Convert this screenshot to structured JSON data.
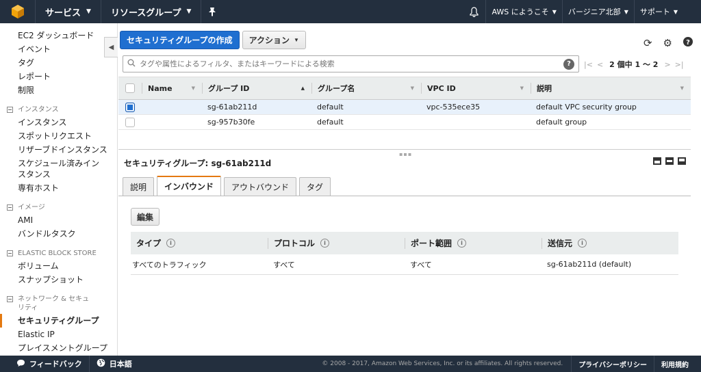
{
  "topnav": {
    "services": "サービス",
    "resource_groups": "リソースグループ",
    "account": "AWS にようこそ",
    "region": "バージニア北部",
    "support": "サポート"
  },
  "sidebar": {
    "top_items": [
      "EC2 ダッシュボード",
      "イベント",
      "タグ",
      "レポート",
      "制限"
    ],
    "sections": [
      {
        "title": "インスタンス",
        "items": [
          "インスタンス",
          "スポットリクエスト",
          "リザーブドインスタンス",
          "スケジュール済みインスタンス",
          "専有ホスト"
        ]
      },
      {
        "title": "イメージ",
        "items": [
          "AMI",
          "バンドルタスク"
        ]
      },
      {
        "title": "ELASTIC BLOCK STORE",
        "items": [
          "ボリューム",
          "スナップショット"
        ]
      },
      {
        "title": "ネットワーク & セキュリティ",
        "items": [
          "セキュリティグループ",
          "Elastic IP",
          "プレイスメントグループ"
        ]
      }
    ]
  },
  "toolbar": {
    "create_label": "セキュリティグループの作成",
    "actions_label": "アクション"
  },
  "search": {
    "placeholder": "タグや属性によるフィルタ、またはキーワードによる検索"
  },
  "pager": {
    "text": "2 個中 1 〜 2"
  },
  "table": {
    "columns": [
      "Name",
      "グループ ID",
      "グループ名",
      "VPC ID",
      "説明"
    ],
    "rows": [
      {
        "name": "",
        "group_id": "sg-61ab211d",
        "group_name": "default",
        "vpc_id": "vpc-535ece35",
        "description": "default VPC security group",
        "selected": true
      },
      {
        "name": "",
        "group_id": "sg-957b30fe",
        "group_name": "default",
        "vpc_id": "",
        "description": "default group",
        "selected": false
      }
    ]
  },
  "detail": {
    "title": "セキュリティグループ: sg-61ab211d",
    "tabs": [
      "説明",
      "インバウンド",
      "アウトバウンド",
      "タグ"
    ],
    "active_tab": 1,
    "edit_label": "編集",
    "rule_columns": [
      "タイプ",
      "プロトコル",
      "ポート範囲",
      "送信元"
    ],
    "rules": [
      {
        "type": "すべてのトラフィック",
        "protocol": "すべて",
        "port_range": "すべて",
        "source": "sg-61ab211d (default)"
      }
    ]
  },
  "footer": {
    "feedback": "フィードバック",
    "language": "日本語",
    "copyright": "© 2008 - 2017, Amazon Web Services, Inc. or its affiliates. All rights reserved.",
    "privacy": "プライバシーポリシー",
    "terms": "利用規約"
  },
  "colors": {
    "nav_bg": "#232f3e",
    "primary": "#1f6fd0",
    "accent": "#e47911",
    "selected_row": "#e8f1fb"
  }
}
